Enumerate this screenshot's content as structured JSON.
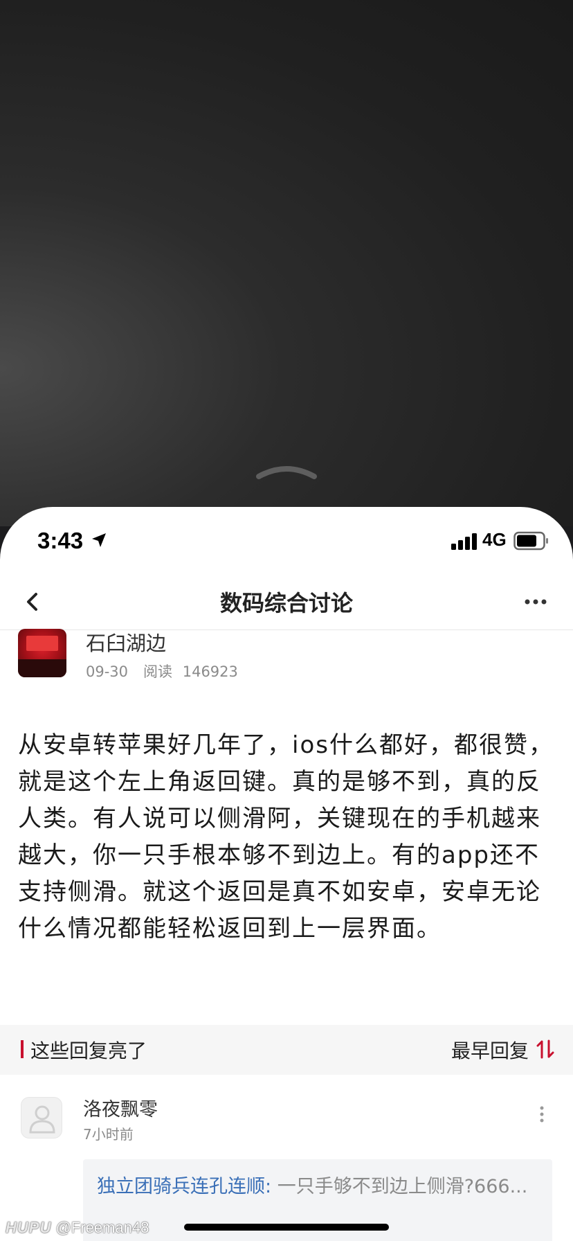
{
  "status_bar": {
    "time": "3:43",
    "network": "4G"
  },
  "nav": {
    "title": "数码综合讨论"
  },
  "post": {
    "author": "石臼湖边",
    "date": "09-30",
    "read_label": "阅读",
    "read_count": "146923",
    "body": "从安卓转苹果好几年了，ios什么都好，都很赞，就是这个左上角返回键。真的是够不到，真的反人类。有人说可以侧滑阿，关键现在的手机越来越大，你一只手根本够不到边上。有的app还不支持侧滑。就这个返回是真不如安卓，安卓无论什么情况都能轻松返回到上一层界面。"
  },
  "replies": {
    "section_title": "这些回复亮了",
    "sort_label": "最早回复",
    "items": [
      {
        "author": "洛夜飘零",
        "time": "7小时前",
        "quote_author": "独立团骑兵连孔连顺:",
        "quote_text": "一只手够不到边上侧滑?666..."
      }
    ]
  },
  "watermark": {
    "brand": "HUPU",
    "handle": "@Freeman48"
  },
  "colors": {
    "accent": "#c8102e",
    "link": "#3a6fb7"
  }
}
